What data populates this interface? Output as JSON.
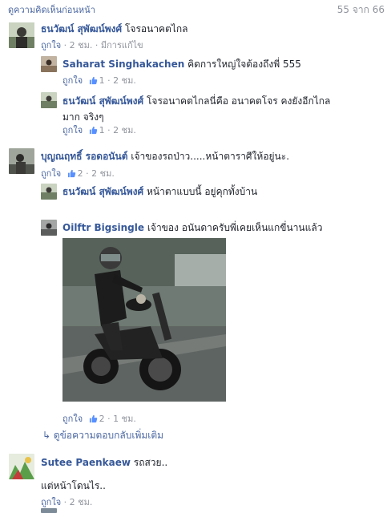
{
  "header": {
    "prev_link": "ดูความคิดเห็นก่อนหน้า",
    "counter": "55 จาก 66"
  },
  "comments": [
    {
      "author": "ธนวัฒน์ สุพัฒน์พงศ์",
      "text": "โจรอนาคตไกล",
      "meta": {
        "like": "ถูกใจ",
        "time": "2 ชม.",
        "edited": "มีการแก้ไข"
      },
      "replies": [
        {
          "author": "Saharat Singhakachen",
          "text": "คิดการใหญ่ใจต้องถึงพี่ 555",
          "meta": {
            "like": "ถูกใจ",
            "likes": "1",
            "time": "2 ชม."
          }
        },
        {
          "author": "ธนวัฒน์ สุพัฒน์พงศ์",
          "text_line1": "โจรอนาคตไกลนี่คือ อนาคตโจร คงยังอีกไกล",
          "text_line2": "มาก จริงๆ",
          "meta": {
            "like": "ถูกใจ",
            "likes": "1",
            "time": "2 ชม."
          }
        }
      ]
    },
    {
      "author": "บุญณฤทธิ์ รอดอนันต์",
      "text": "เจ้าของรถป่าว.....หน้าตาราศีให้อยู่นะ.",
      "meta": {
        "like": "ถูกใจ",
        "likes": "2",
        "time": "2 ชม."
      },
      "replies": [
        {
          "author": "ธนวัฒน์ สุพัฒน์พงศ์",
          "text": "หน้าตาแบบนี้ อยู่คุกทั้งบ้าน"
        },
        {
          "author": "Oilftr Bigsingle",
          "text": "เจ้าของ อนันดาครับพี่เคยเห็นแกขี่นานแล้ว",
          "meta": {
            "like": "ถูกใจ",
            "likes": "2",
            "time": "1 ชม."
          }
        }
      ],
      "more_replies": "ดูข้อความตอบกลับเพิ่มเติม"
    },
    {
      "author": "Sutee Paenkaew",
      "text": "รถสวย..",
      "text2": "แต่หน้าโดนไร..",
      "meta": {
        "like": "ถูกใจ",
        "time": "2 ชม."
      }
    }
  ],
  "sep": "·",
  "colors": {
    "link": "#365899",
    "meta": "#90949c",
    "like_blue": "#4b67a1"
  }
}
